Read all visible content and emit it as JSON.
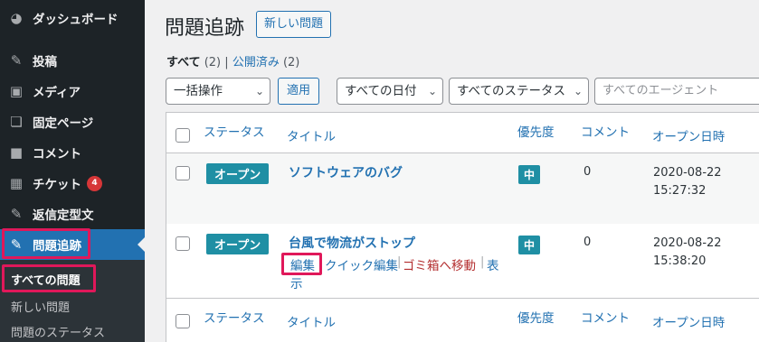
{
  "sidebar": {
    "items": [
      {
        "label": "ダッシュボード",
        "icon": "dashboard-icon",
        "glyph": "◕"
      },
      {
        "label": "投稿",
        "icon": "pin-icon",
        "glyph": "✎"
      },
      {
        "label": "メディア",
        "icon": "media-icon",
        "glyph": "▣"
      },
      {
        "label": "固定ページ",
        "icon": "page-icon",
        "glyph": "❏"
      },
      {
        "label": "コメント",
        "icon": "comment-icon",
        "glyph": "■"
      },
      {
        "label": "チケット",
        "icon": "ticket-icon",
        "glyph": "▦",
        "badge": "4"
      },
      {
        "label": "返信定型文",
        "icon": "pin-icon",
        "glyph": "✎"
      },
      {
        "label": "問題追跡",
        "icon": "pin-icon",
        "glyph": "✎"
      }
    ],
    "submenu": [
      "すべての問題",
      "新しい問題",
      "問題のステータス"
    ]
  },
  "header": {
    "title": "問題追跡",
    "add_new": "新しい問題"
  },
  "views": {
    "all_label": "すべて",
    "all_count": "(2)",
    "separator": "|",
    "published_label": "公開済み",
    "published_count": "(2)"
  },
  "filters": {
    "bulk": "一括操作",
    "apply": "適用",
    "dates": "すべての日付",
    "statuses": "すべてのステータス",
    "agent_placeholder": "すべてのエージェント"
  },
  "table": {
    "columns": {
      "status": "ステータス",
      "title": "タイトル",
      "priority": "優先度",
      "comments": "コメント",
      "opened": "オープン日時"
    },
    "rows": [
      {
        "status": "オープン",
        "title": "ソフトウェアのバグ",
        "priority": "中",
        "comments": "0",
        "date": "2020-08-22",
        "time": "15:27:32"
      },
      {
        "status": "オープン",
        "title": "台風で物流がストップ",
        "priority": "中",
        "comments": "0",
        "date": "2020-08-22",
        "time": "15:38:20"
      }
    ],
    "row_actions": {
      "edit": "編集",
      "quick_edit": "クイック編集",
      "trash": "ゴミ箱へ移動",
      "view_1": "表",
      "view_2": "示",
      "sep": "|"
    }
  },
  "colors": {
    "accent": "#2271b1",
    "sidebar_bg": "#1d2327",
    "status_bg": "#1f8fa4",
    "highlight": "#e0185a",
    "badge": "#d63638"
  }
}
